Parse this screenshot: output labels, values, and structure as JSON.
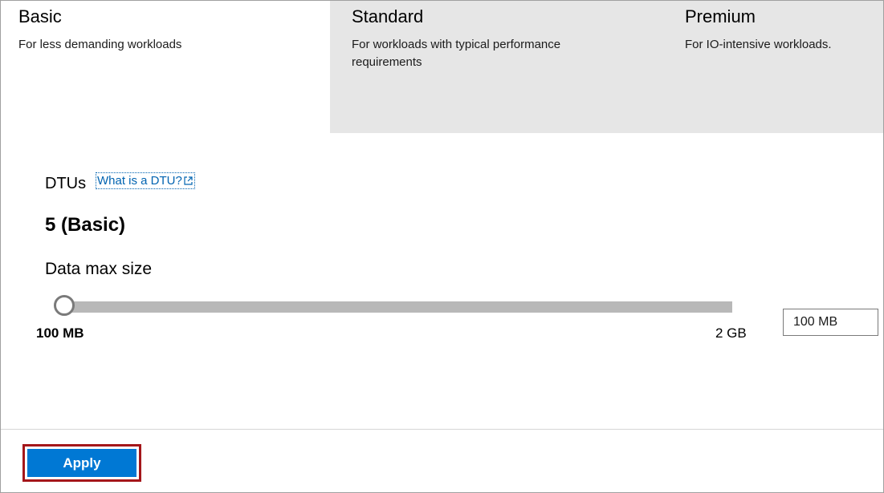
{
  "tiers": [
    {
      "name": "Basic",
      "description": "For less demanding workloads",
      "selected": true
    },
    {
      "name": "Standard",
      "description": "For workloads with typical performance requirements",
      "selected": false
    },
    {
      "name": "Premium",
      "description": "For IO-intensive workloads.",
      "selected": false
    }
  ],
  "dtu": {
    "label": "DTUs",
    "help_link": "What is a DTU?",
    "value": "5 (Basic)"
  },
  "data_size": {
    "label": "Data max size",
    "slider_min_label": "100 MB",
    "slider_max_label": "2 GB",
    "slider_fraction": 0.0,
    "input_value": "100 MB"
  },
  "footer": {
    "apply_label": "Apply"
  },
  "colors": {
    "accent": "#0078d4",
    "link": "#0063b1",
    "highlight": "#a4161a",
    "unselected_tier": "#e6e6e6"
  },
  "icons": {
    "help_link": "external-link-icon"
  }
}
